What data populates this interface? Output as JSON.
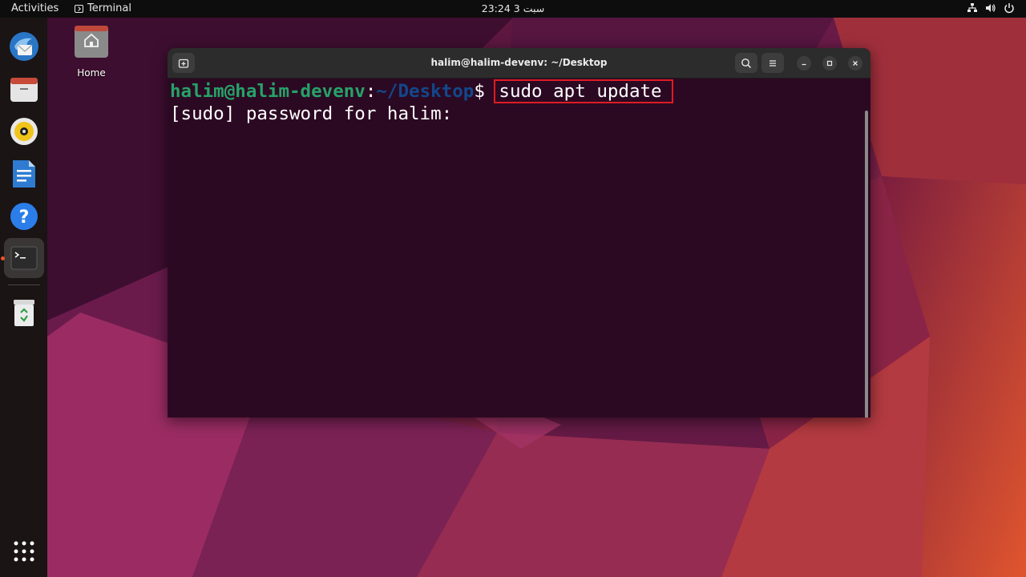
{
  "topbar": {
    "activities": "Activities",
    "app_name": "Terminal",
    "clock": "23:24  سبت 3"
  },
  "dock": {
    "items": [
      "thunderbird-icon",
      "files-icon",
      "rhythmbox-icon",
      "libreoffice-writer-icon",
      "help-icon",
      "terminal-icon",
      "trash-icon"
    ],
    "grid": "show-applications-icon"
  },
  "desktop": {
    "home_label": "Home"
  },
  "terminal": {
    "title": "halim@halim-devenv: ~/Desktop",
    "prompt_user": "halim@halim-devenv",
    "prompt_colon": ":",
    "prompt_path": "~/Desktop",
    "prompt_dollar": "$ ",
    "command": "sudo apt update",
    "line2": "[sudo] password for halim:"
  },
  "colors": {
    "accent": "#e95420",
    "highlight": "#e01b24",
    "terminal_bg": "#300a24",
    "prompt_green": "#26a269",
    "prompt_blue": "#12488b"
  }
}
